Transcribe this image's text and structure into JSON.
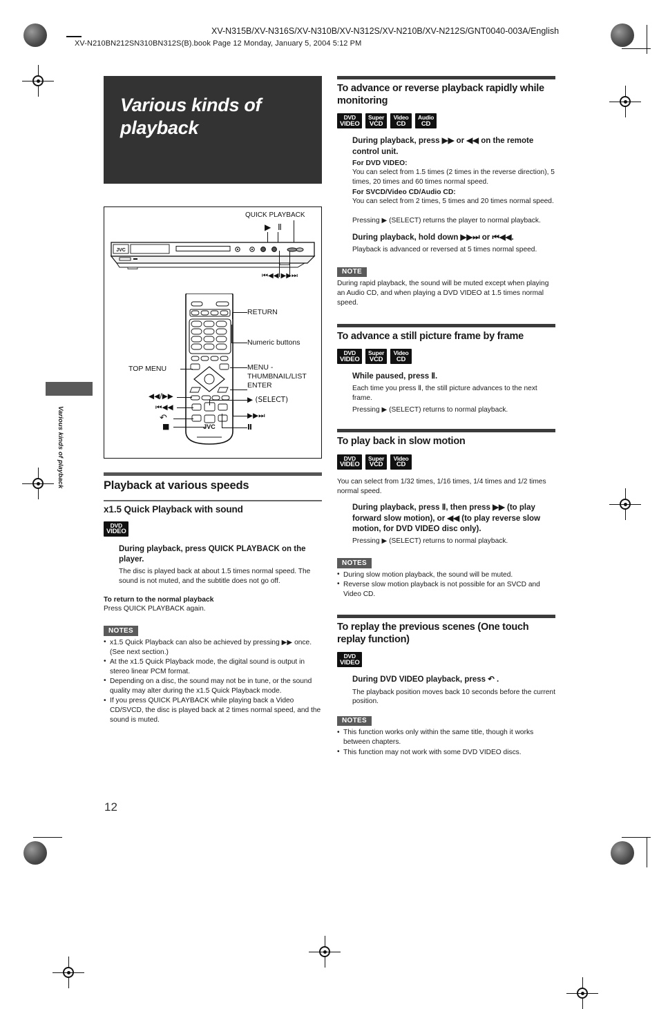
{
  "header": {
    "model_line": "XV-N315B/XV-N316S/XV-N310B/XV-N312S/XV-N210B/XV-N212S/GNT0040-003A/English",
    "file_line": "XV-N210BN212SN310BN312S(B).book  Page 12  Monday, January 5, 2004  5:12 PM"
  },
  "page_number": "12",
  "side_tab_label": "Various kinds of playback",
  "chapter": {
    "title": "Various kinds of playback"
  },
  "illustration": {
    "player_label": "QUICK PLAYBACK",
    "player_glyphs": "▶ Ⅱ",
    "player_skip_glyphs": "⏮◀◀  ▶▶⏭",
    "jvc_logo": "JVC",
    "callouts": {
      "return": "RETURN",
      "numeric": "Numeric buttons",
      "top_menu": "TOP MENU",
      "menu_thumbnail": "MENU -\nTHUMBNAIL/LIST\nENTER",
      "select": "▶ (SELECT)",
      "ff_rew": "◀◀/▶▶",
      "prev": "⏮◀◀",
      "replay": "↶",
      "stop": "■",
      "next": "▶▶⏭",
      "pause": "Ⅱ"
    }
  },
  "left_column": {
    "section_title": "Playback at various speeds",
    "subsection_title": "x1.5 Quick Playback with sound",
    "badges": [
      {
        "line1": "DVD",
        "line2": "VIDEO"
      }
    ],
    "instruction_title": "During playback, press QUICK PLAYBACK on the player.",
    "instruction_body": "The disc is played back at about 1.5 times normal speed. The sound is not muted, and the subtitle does not go off.",
    "return_label": "To return to the normal playback",
    "return_body": "Press QUICK PLAYBACK again.",
    "notes_tag": "NOTES",
    "notes": [
      "x1.5 Quick Playback can also be achieved by pressing ▶▶ once. (See next section.)",
      "At the x1.5 Quick Playback mode, the digital sound is output in stereo linear PCM format.",
      "Depending on a disc, the sound may not be in tune, or the sound quality may alter during the x1.5 Quick Playback mode.",
      "If you press QUICK PLAYBACK while playing back a Video CD/SVCD, the disc is played back at 2 times normal speed, and the sound is muted."
    ]
  },
  "right_column": {
    "sections": [
      {
        "heading": "To advance or reverse playback rapidly while monitoring",
        "badges": [
          {
            "line1": "DVD",
            "line2": "VIDEO"
          },
          {
            "line1": "Super",
            "line2": "VCD"
          },
          {
            "line1": "Video",
            "line2": "CD"
          },
          {
            "line1": "Audio",
            "line2": "CD"
          }
        ],
        "instruction_title": "During playback, press ▶▶ or ◀◀ on the remote control unit.",
        "dvd_label": "For DVD VIDEO:",
        "dvd_body": "You can select from 1.5 times (2 times in the reverse direction), 5 times, 20 times and 60 times normal speed.",
        "svcd_label": "For SVCD/Video CD/Audio CD:",
        "svcd_body": "You can select from 2 times, 5 times and 20 times normal speed.",
        "select_note": "Pressing ▶ (SELECT) returns the player to normal playback.",
        "instruction_title2": "During playback, hold down ▶▶⏭ or ⏮◀◀.",
        "instruction_body2": "Playback is advanced or reversed at 5 times normal speed.",
        "note_tag": "NOTE",
        "note_body": "During rapid playback, the sound will be muted except when playing an Audio CD, and when playing a DVD VIDEO at 1.5 times normal speed."
      },
      {
        "heading": "To advance a still picture frame by frame",
        "badges": [
          {
            "line1": "DVD",
            "line2": "VIDEO"
          },
          {
            "line1": "Super",
            "line2": "VCD"
          },
          {
            "line1": "Video",
            "line2": "CD"
          }
        ],
        "instruction_title": "While paused, press Ⅱ.",
        "instruction_body": "Each time you press Ⅱ, the still picture advances to the next frame.",
        "select_note": "Pressing ▶ (SELECT) returns to normal playback."
      },
      {
        "heading": "To play back in slow motion",
        "badges": [
          {
            "line1": "DVD",
            "line2": "VIDEO"
          },
          {
            "line1": "Super",
            "line2": "VCD"
          },
          {
            "line1": "Video",
            "line2": "CD"
          }
        ],
        "intro": "You can select from 1/32 times, 1/16 times, 1/4 times and 1/2 times normal speed.",
        "instruction_title": "During playback, press Ⅱ, then press ▶▶ (to play forward slow motion), or ◀◀ (to play reverse slow motion, for DVD VIDEO disc only).",
        "select_note": "Pressing ▶ (SELECT) returns to normal playback.",
        "notes_tag": "NOTES",
        "notes": [
          "During slow motion playback, the sound will be muted.",
          "Reverse slow motion playback is not possible for an SVCD and Video CD."
        ]
      },
      {
        "heading": "To replay the previous scenes (One touch replay function)",
        "badges": [
          {
            "line1": "DVD",
            "line2": "VIDEO"
          }
        ],
        "instruction_title": "During DVD VIDEO playback, press ↶ .",
        "instruction_body": "The playback position moves back 10 seconds before the current position.",
        "notes_tag": "NOTES",
        "notes": [
          "This function works only within the same title, though it works between chapters.",
          "This function may not work with some DVD VIDEO discs."
        ]
      }
    ]
  }
}
